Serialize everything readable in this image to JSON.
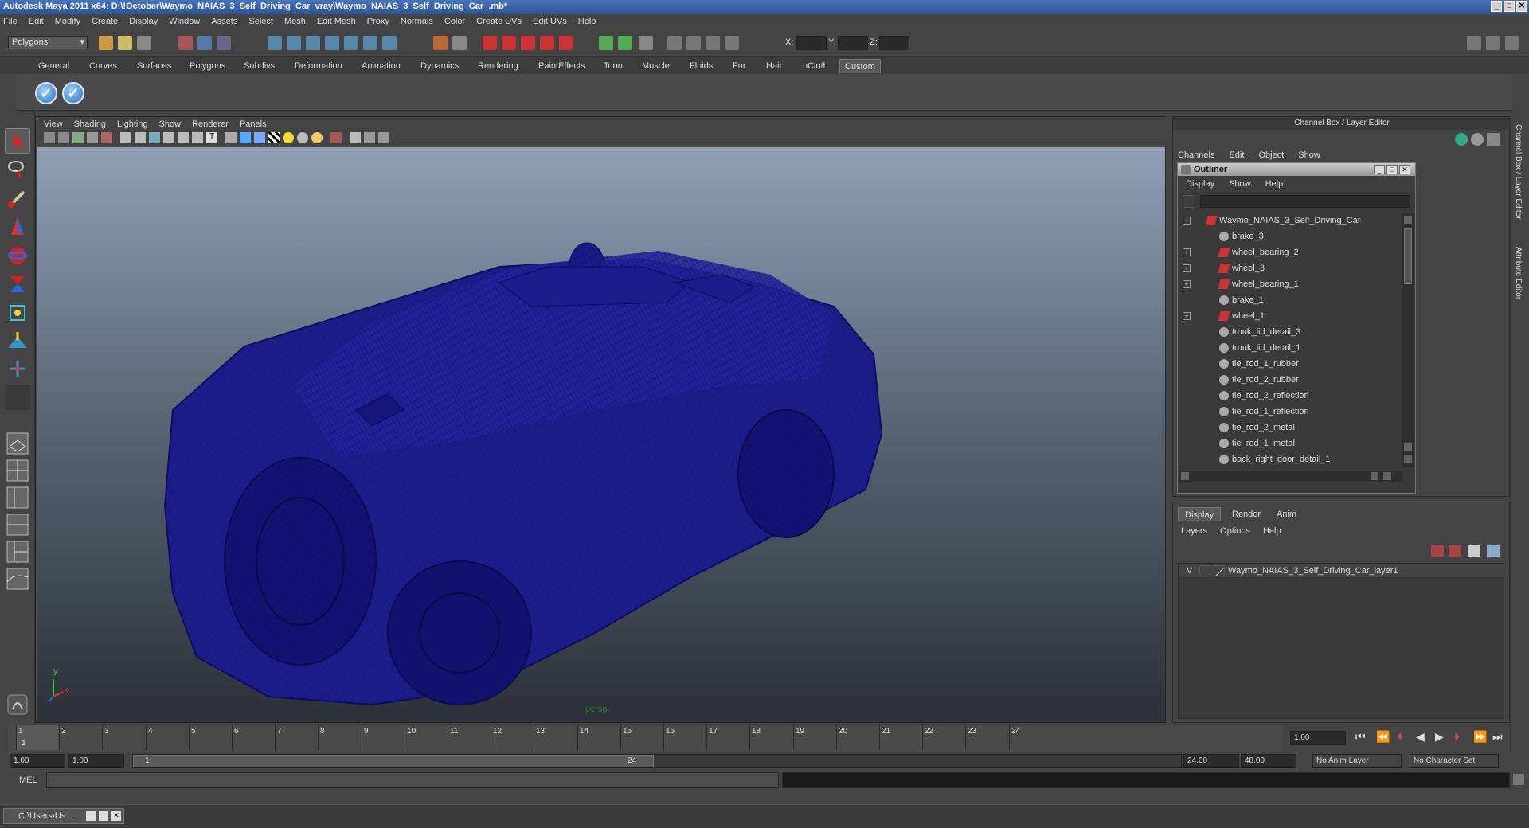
{
  "window": {
    "title": "Autodesk Maya 2011 x64: D:\\!October\\Waymo_NAIAS_3_Self_Driving_Car_vray\\Waymo_NAIAS_3_Self_Driving_Car_.mb*"
  },
  "menubar": [
    "File",
    "Edit",
    "Modify",
    "Create",
    "Display",
    "Window",
    "Assets",
    "Select",
    "Mesh",
    "Edit Mesh",
    "Proxy",
    "Normals",
    "Color",
    "Create UVs",
    "Edit UVs",
    "Help"
  ],
  "status": {
    "mode": "Polygons",
    "x_label": "X:",
    "y_label": "Y:",
    "z_label": "Z:"
  },
  "shelf_tabs": [
    "General",
    "Curves",
    "Surfaces",
    "Polygons",
    "Subdivs",
    "Deformation",
    "Animation",
    "Dynamics",
    "Rendering",
    "PaintEffects",
    "Toon",
    "Muscle",
    "Fluids",
    "Fur",
    "Hair",
    "nCloth",
    "Custom"
  ],
  "shelf_active": "Custom",
  "viewport": {
    "menu": [
      "View",
      "Shading",
      "Lighting",
      "Show",
      "Renderer",
      "Panels"
    ],
    "camera": "persp",
    "axis_y": "y",
    "axis_x": "x"
  },
  "channel_box": {
    "title": "Channel Box / Layer Editor",
    "menu": [
      "Channels",
      "Edit",
      "Object",
      "Show"
    ]
  },
  "outliner": {
    "title": "Outliner",
    "menu": [
      "Display",
      "Show",
      "Help"
    ],
    "items": [
      {
        "label": "Waymo_NAIAS_3_Self_Driving_Car",
        "expander": "−",
        "type": "transform",
        "indent": 0
      },
      {
        "label": "brake_3",
        "expander": "",
        "type": "mesh",
        "indent": 1
      },
      {
        "label": "wheel_bearing_2",
        "expander": "+",
        "type": "transform",
        "indent": 1
      },
      {
        "label": "wheel_3",
        "expander": "+",
        "type": "transform",
        "indent": 1
      },
      {
        "label": "wheel_bearing_1",
        "expander": "+",
        "type": "transform",
        "indent": 1
      },
      {
        "label": "brake_1",
        "expander": "",
        "type": "mesh",
        "indent": 1
      },
      {
        "label": "wheel_1",
        "expander": "+",
        "type": "transform",
        "indent": 1
      },
      {
        "label": "trunk_lid_detail_3",
        "expander": "",
        "type": "mesh",
        "indent": 1
      },
      {
        "label": "trunk_lid_detail_1",
        "expander": "",
        "type": "mesh",
        "indent": 1
      },
      {
        "label": "tie_rod_1_rubber",
        "expander": "",
        "type": "mesh",
        "indent": 1
      },
      {
        "label": "tie_rod_2_rubber",
        "expander": "",
        "type": "mesh",
        "indent": 1
      },
      {
        "label": "tie_rod_2_reflection",
        "expander": "",
        "type": "mesh",
        "indent": 1
      },
      {
        "label": "tie_rod_1_reflection",
        "expander": "",
        "type": "mesh",
        "indent": 1
      },
      {
        "label": "tie_rod_2_metal",
        "expander": "",
        "type": "mesh",
        "indent": 1
      },
      {
        "label": "tie_rod_1_metal",
        "expander": "",
        "type": "mesh",
        "indent": 1
      },
      {
        "label": "back_right_door_detail_1",
        "expander": "",
        "type": "mesh",
        "indent": 1
      }
    ]
  },
  "layer_editor": {
    "tabs": [
      "Display",
      "Render",
      "Anim"
    ],
    "active_tab": "Display",
    "menu": [
      "Layers",
      "Options",
      "Help"
    ],
    "layers": [
      {
        "visible": "V",
        "name": "Waymo_NAIAS_3_Self_Driving_Car_layer1"
      }
    ]
  },
  "side_tabs": [
    "Channel Box / Layer Editor",
    "Attribute Editor"
  ],
  "timeline": {
    "frames": [
      "1",
      "2",
      "3",
      "4",
      "5",
      "6",
      "7",
      "8",
      "9",
      "10",
      "11",
      "12",
      "13",
      "14",
      "15",
      "16",
      "17",
      "18",
      "19",
      "20",
      "21",
      "22",
      "23",
      "24"
    ],
    "current_frame": "1",
    "current_time_field": "1.00"
  },
  "range": {
    "start": "1.00",
    "playback_start": "1.00",
    "slider_start": "1",
    "slider_end": "24",
    "playback_end": "24.00",
    "end": "48.00",
    "anim_layer": "No Anim Layer",
    "character_set": "No Character Set"
  },
  "command": {
    "label": "MEL"
  },
  "taskbar": {
    "item": "C:\\Users\\Us..."
  },
  "colors": {
    "wire": "#101070",
    "accent": "#2a55a0"
  }
}
